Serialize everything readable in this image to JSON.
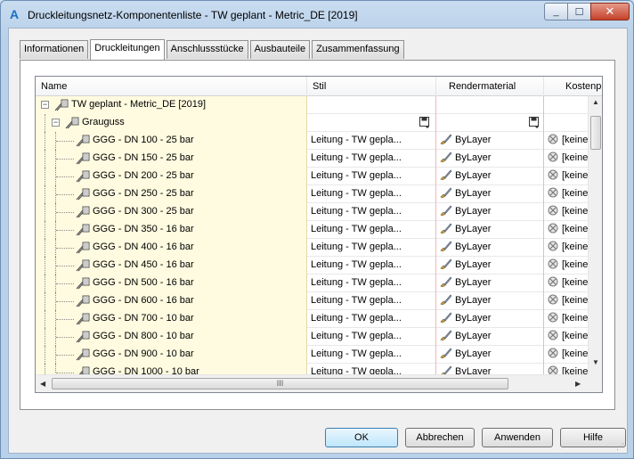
{
  "window": {
    "title": "Druckleitungsnetz-Komponentenliste - TW geplant - Metric_DE [2019]",
    "app_icon": "autocad-a-icon",
    "controls": {
      "minimize": "_",
      "maximize": "☐",
      "close": "✕"
    }
  },
  "tabs": [
    {
      "label": "Informationen",
      "active": false
    },
    {
      "label": "Druckleitungen",
      "active": true
    },
    {
      "label": "Anschlussstücke",
      "active": false
    },
    {
      "label": "Ausbauteile",
      "active": false
    },
    {
      "label": "Zusammenfassung",
      "active": false
    }
  ],
  "grid": {
    "columns": [
      "Name",
      "Stil",
      "Rendermaterial",
      "Kostenpu"
    ],
    "root": {
      "name": "TW geplant - Metric_DE [2019]",
      "expander": "−"
    },
    "group": {
      "name": "Grauguss",
      "expander": "−"
    },
    "rows": [
      {
        "name": "GGG - DN 100 - 25 bar",
        "stil": "Leitung - TW gepla...",
        "render": "ByLayer",
        "kosten": "[keine"
      },
      {
        "name": "GGG - DN 150 - 25 bar",
        "stil": "Leitung - TW gepla...",
        "render": "ByLayer",
        "kosten": "[keine"
      },
      {
        "name": "GGG - DN 200 - 25 bar",
        "stil": "Leitung - TW gepla...",
        "render": "ByLayer",
        "kosten": "[keine"
      },
      {
        "name": "GGG - DN 250 - 25 bar",
        "stil": "Leitung - TW gepla...",
        "render": "ByLayer",
        "kosten": "[keine"
      },
      {
        "name": "GGG - DN 300 - 25 bar",
        "stil": "Leitung - TW gepla...",
        "render": "ByLayer",
        "kosten": "[keine"
      },
      {
        "name": "GGG - DN 350 - 16 bar",
        "stil": "Leitung - TW gepla...",
        "render": "ByLayer",
        "kosten": "[keine"
      },
      {
        "name": "GGG - DN 400 - 16 bar",
        "stil": "Leitung - TW gepla...",
        "render": "ByLayer",
        "kosten": "[keine"
      },
      {
        "name": "GGG - DN 450 - 16 bar",
        "stil": "Leitung - TW gepla...",
        "render": "ByLayer",
        "kosten": "[keine"
      },
      {
        "name": "GGG - DN 500 - 16 bar",
        "stil": "Leitung - TW gepla...",
        "render": "ByLayer",
        "kosten": "[keine"
      },
      {
        "name": "GGG - DN 600 - 16 bar",
        "stil": "Leitung - TW gepla...",
        "render": "ByLayer",
        "kosten": "[keine"
      },
      {
        "name": "GGG - DN 700 - 10 bar",
        "stil": "Leitung - TW gepla...",
        "render": "ByLayer",
        "kosten": "[keine"
      },
      {
        "name": "GGG - DN 800 - 10 bar",
        "stil": "Leitung - TW gepla...",
        "render": "ByLayer",
        "kosten": "[keine"
      },
      {
        "name": "GGG - DN 900 - 10 bar",
        "stil": "Leitung - TW gepla...",
        "render": "ByLayer",
        "kosten": "[keine"
      },
      {
        "name": "GGG - DN 1000 - 10 bar",
        "stil": "Leitung - TW gepla...",
        "render": "ByLayer",
        "kosten": "[keine"
      }
    ],
    "hscroll_thumb_glyph": "III"
  },
  "buttons": {
    "ok": "OK",
    "cancel": "Abbrechen",
    "apply": "Anwenden",
    "help": "Hilfe"
  }
}
